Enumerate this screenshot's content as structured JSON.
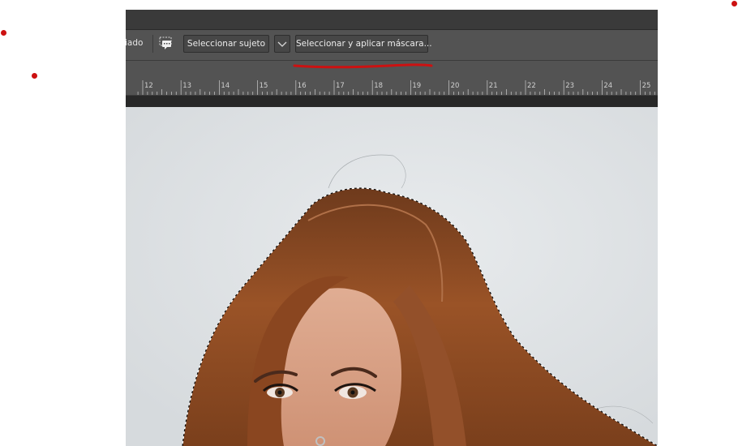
{
  "options_bar": {
    "partial_label": "iado",
    "select_subject_label": "Seleccionar sujeto",
    "select_and_mask_label": "Seleccionar y aplicar máscara..."
  },
  "ruler": {
    "ticks": [
      "12",
      "13",
      "14",
      "15",
      "16",
      "17",
      "18",
      "19",
      "20",
      "21",
      "22",
      "23",
      "24",
      "25"
    ]
  },
  "colors": {
    "annotation": "#cc1111",
    "hair": "#8a4a22",
    "skin": "#d9a287",
    "backdrop": "#dfe3e5"
  },
  "icons": {
    "feedback": "speech-bubble-icon",
    "dropdown": "chevron-down-icon"
  }
}
